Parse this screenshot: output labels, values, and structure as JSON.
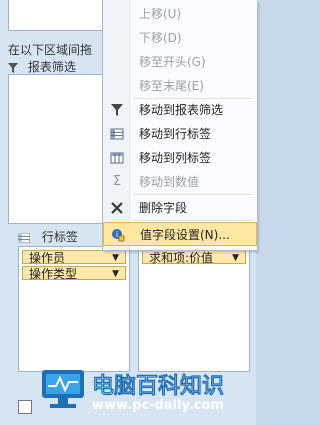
{
  "pivot_pane": {
    "header_text": "在以下区域间拖",
    "report_filter_label": "报表筛选",
    "row_labels_label": "行标签",
    "row_fields": [
      "操作员",
      "操作类型"
    ],
    "values_field": "求和项:价值"
  },
  "context_menu": {
    "items": [
      {
        "label": "上移(U)",
        "disabled": true,
        "icon": ""
      },
      {
        "label": "下移(D)",
        "disabled": true,
        "icon": ""
      },
      {
        "label": "移至开头(G)",
        "disabled": true,
        "icon": ""
      },
      {
        "label": "移至末尾(E)",
        "disabled": true,
        "icon": ""
      },
      {
        "label": "移动到报表筛选",
        "disabled": false,
        "icon": "filter-icon"
      },
      {
        "label": "移动到行标签",
        "disabled": false,
        "icon": "row-labels-icon"
      },
      {
        "label": "移动到列标签",
        "disabled": false,
        "icon": "column-labels-icon"
      },
      {
        "label": "移动到数值",
        "disabled": true,
        "icon": "sigma-icon"
      },
      {
        "label": "删除字段",
        "disabled": false,
        "icon": "delete-x-icon"
      },
      {
        "label": "值字段设置(N)...",
        "disabled": false,
        "selected": true,
        "icon": "value-field-settings-icon"
      }
    ]
  },
  "watermark": {
    "title": "电脑百科知识",
    "url": "www.pc-daily.com"
  }
}
